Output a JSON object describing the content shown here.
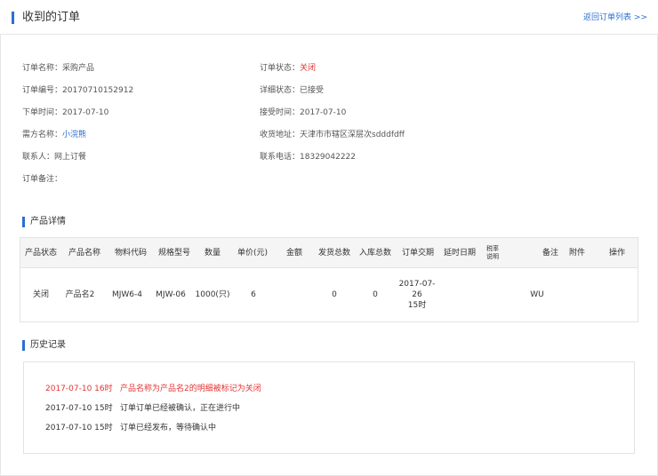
{
  "header": {
    "title": "收到的订单",
    "back_link": "返回订单列表 >>"
  },
  "order_info": {
    "left": [
      {
        "label": "订单名称：",
        "value": "采购产品"
      },
      {
        "label": "订单编号：",
        "value": "20170710152912"
      },
      {
        "label": "下单时间：",
        "value": "2017-07-10"
      },
      {
        "label": "需方名称：",
        "value": "小浣熊"
      },
      {
        "label": "联系人：",
        "value": "网上订餐"
      },
      {
        "label": "订单备注：",
        "value": ""
      }
    ],
    "right": [
      {
        "label": "订单状态：",
        "value": "关闭"
      },
      {
        "label": "详细状态：",
        "value": "已接受"
      },
      {
        "label": "接受时间：",
        "value": "2017-07-10"
      },
      {
        "label": "收货地址：",
        "value": "天津市市辖区深层次sdddfdff"
      },
      {
        "label": "联系电话：",
        "value": "18329042222"
      }
    ]
  },
  "products": {
    "section_title": "产品详情",
    "headers": [
      "产品状态",
      "产品名称",
      "物料代码",
      "规格型号",
      "数量",
      "单价(元)",
      "金额",
      "发货总数",
      "入库总数",
      "订单交期",
      "延时日期",
      "税率\n说明",
      "备注",
      "附件",
      "操作"
    ],
    "rows": [
      [
        "关闭",
        "产品名2",
        "MJW6-4",
        "MJW-06",
        "1000(只)",
        "6",
        "",
        "0",
        "0",
        "2017-07-26\n15时",
        "",
        "",
        "WU",
        "",
        ""
      ]
    ]
  },
  "history": {
    "section_title": "历史记录",
    "entries": [
      {
        "time": "2017-07-10 16时",
        "message": "产品名称为产品名2的明细被标记为关闭"
      },
      {
        "time": "2017-07-10 15时",
        "message": "订单订单已经被确认，正在进行中"
      },
      {
        "time": "2017-07-10 15时",
        "message": "订单已经发布，等待确认中"
      }
    ]
  },
  "colors": {
    "accent": "#2b6fd1",
    "status_red": "#e53333"
  }
}
